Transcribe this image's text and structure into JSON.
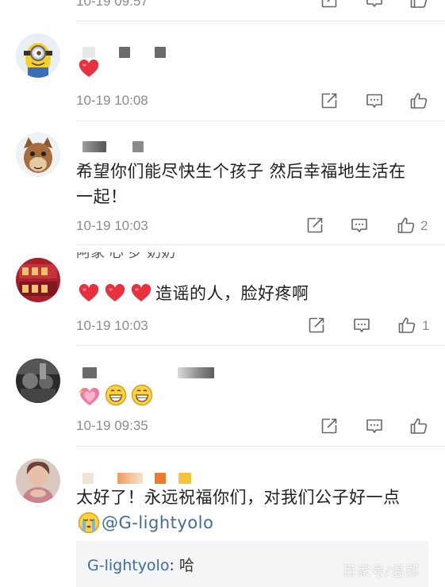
{
  "comments": [
    {
      "timestamp": "10-19 09:57"
    },
    {
      "timestamp": "10-19 10:08",
      "hearts": 1
    },
    {
      "text_line1": "希望你们能尽快生个孩子 然后幸福地生活在",
      "text_line2": "一起！",
      "timestamp": "10-19 10:03",
      "likes": "2"
    },
    {
      "username_partial": "阿家 心 罗 奶奶",
      "text": "造谣的人，脸好疼啊",
      "hearts": 3,
      "timestamp": "10-19 10:03",
      "likes": "1"
    },
    {
      "timestamp": "10-19 09:35"
    },
    {
      "text": "太好了！永远祝福你们，对我们公子好一点",
      "mention": "@G-lightyolo",
      "reply": {
        "name": "G-lightyolo",
        "sep": ": ",
        "text": "哈"
      }
    }
  ],
  "actions": {
    "forward_icon": "share-square-icon",
    "comment_icon": "comment-icon",
    "like_icon": "thumbs-up-icon"
  },
  "colors": {
    "timestamp": "#8c8c8c",
    "mention": "#3e6aa6",
    "heart": "#e8303f",
    "divider": "#ececec"
  },
  "watermark": "百家号/温郑"
}
